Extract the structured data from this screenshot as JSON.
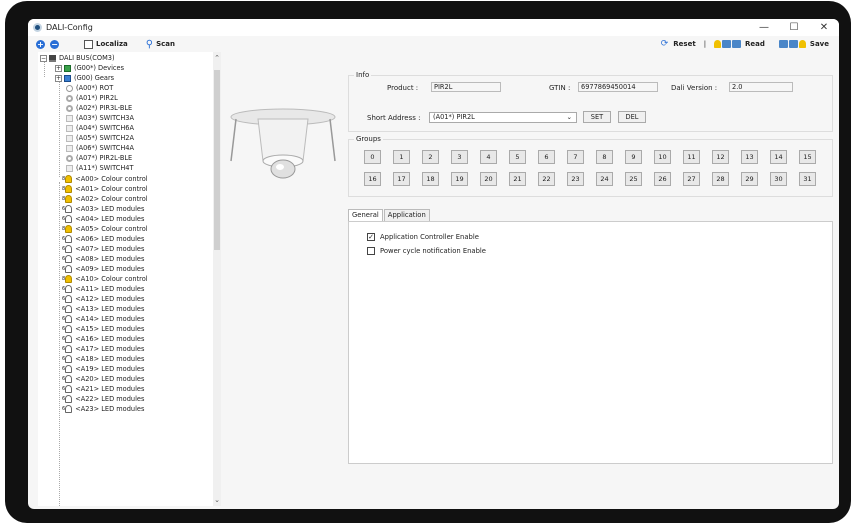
{
  "window": {
    "title": "DALI-Config",
    "min": "—",
    "max": "☐",
    "close": "✕"
  },
  "toolbar": {
    "localiza": "Localiza",
    "scan": "Scan",
    "reset": "Reset",
    "sep": "|",
    "read": "Read",
    "save": "Save"
  },
  "tree": {
    "root": "DALI BUS(COM3)",
    "devices": "(G00*) Devices",
    "gears": "(G00) Gears",
    "device_items": [
      "(A00*) ROT",
      "(A01*) PIR2L",
      "(A02*) PIR3L-BLE",
      "(A03*) SWITCH3A",
      "(A04*) SWITCH6A",
      "(A05*) SWITCH2A",
      "(A06*) SWITCH4A",
      "(A07*) PIR2L-BLE",
      "(A11*) SWITCH4T"
    ],
    "gear_items": [
      "<A00> Colour control",
      "<A01> Colour control",
      "<A02> Colour control",
      "<A03> LED modules",
      "<A04> LED modules",
      "<A05> Colour control",
      "<A06> LED modules",
      "<A07> LED modules",
      "<A08> LED modules",
      "<A09> LED modules",
      "<A10> Colour control",
      "<A11> LED modules",
      "<A12> LED modules",
      "<A13> LED modules",
      "<A14> LED modules",
      "<A15> LED modules",
      "<A16> LED modules",
      "<A17> LED modules",
      "<A18> LED modules",
      "<A19> LED modules",
      "<A20> LED modules",
      "<A21> LED modules",
      "<A22> LED modules",
      "<A23> LED modules"
    ],
    "gear_levels": [
      "8",
      "8",
      "8",
      "6",
      "6",
      "8",
      "6",
      "6",
      "6",
      "6",
      "8",
      "6",
      "6",
      "6",
      "6",
      "6",
      "6",
      "6",
      "6",
      "6",
      "6",
      "6",
      "6",
      "6"
    ],
    "gear_color": [
      1,
      1,
      1,
      0,
      0,
      1,
      0,
      0,
      0,
      0,
      1,
      0,
      0,
      0,
      0,
      0,
      0,
      0,
      0,
      0,
      0,
      0,
      0,
      0
    ]
  },
  "info": {
    "legend": "Info",
    "product_label": "Product :",
    "product": "PIR2L",
    "gtin_label": "GTIN :",
    "gtin": "6977869450014",
    "dali_label": "Dali Version :",
    "dali": "2.0",
    "addr_label": "Short Address :",
    "addr": "(A01*) PIR2L",
    "set": "SET",
    "del": "DEL"
  },
  "groups": {
    "legend": "Groups",
    "row1": [
      "0",
      "1",
      "2",
      "3",
      "4",
      "5",
      "6",
      "7",
      "8",
      "9",
      "10",
      "11",
      "12",
      "13",
      "14",
      "15"
    ],
    "row2": [
      "16",
      "17",
      "18",
      "19",
      "20",
      "21",
      "22",
      "23",
      "24",
      "25",
      "26",
      "27",
      "28",
      "29",
      "30",
      "31"
    ]
  },
  "tabs": [
    "General",
    "Application"
  ],
  "options": [
    {
      "label": "Application Controller Enable",
      "checked": true
    },
    {
      "label": "Power cycle notification Enable",
      "checked": false
    }
  ],
  "colors": {
    "bulb": "#f0c000",
    "accent": "#2a6fd6"
  }
}
